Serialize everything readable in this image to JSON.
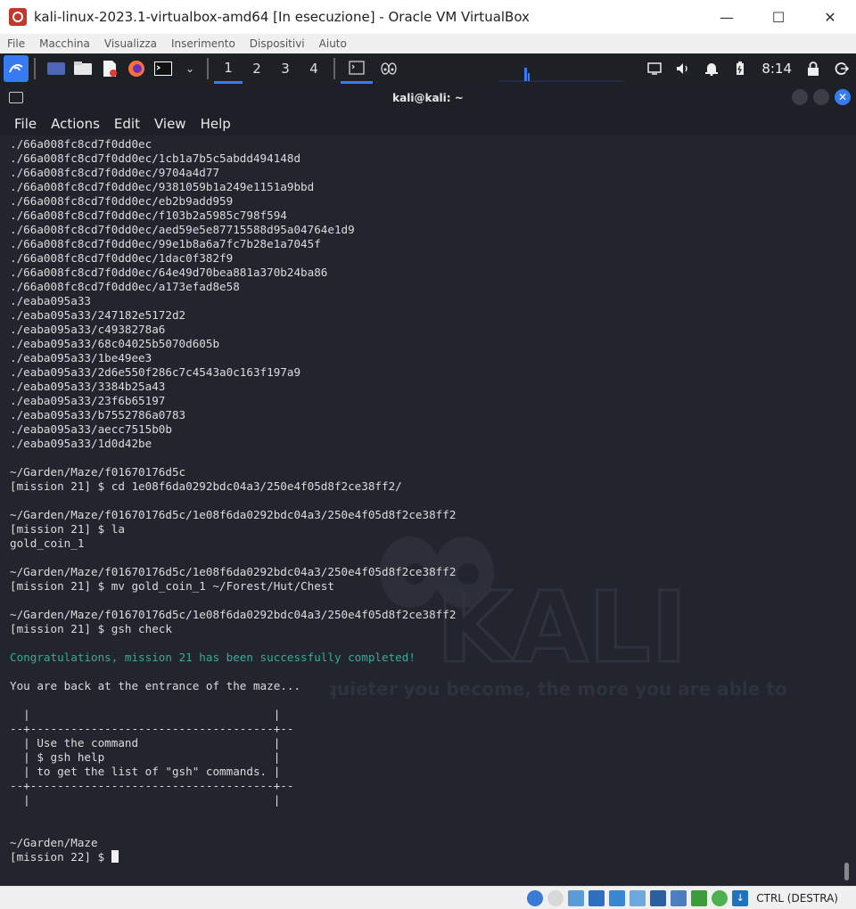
{
  "window": {
    "title": "kali-linux-2023.1-virtualbox-amd64 [In esecuzione] - Oracle VM VirtualBox",
    "minimize": "—",
    "maximize": "☐",
    "close": "✕"
  },
  "host_menu": [
    "File",
    "Macchina",
    "Visualizza",
    "Inserimento",
    "Dispositivi",
    "Aiuto"
  ],
  "guest_panel": {
    "workspaces": [
      "1",
      "2",
      "3",
      "4"
    ],
    "active_workspace": "1",
    "clock": "8:14"
  },
  "terminal": {
    "title": "kali@kali: ~",
    "menu": [
      "File",
      "Actions",
      "Edit",
      "View",
      "Help"
    ],
    "lines": [
      "./66a008fc8cd7f0dd0ec",
      "./66a008fc8cd7f0dd0ec/1cb1a7b5c5abdd494148d",
      "./66a008fc8cd7f0dd0ec/9704a4d77",
      "./66a008fc8cd7f0dd0ec/9381059b1a249e1151a9bbd",
      "./66a008fc8cd7f0dd0ec/eb2b9add959",
      "./66a008fc8cd7f0dd0ec/f103b2a5985c798f594",
      "./66a008fc8cd7f0dd0ec/aed59e5e87715588d95a04764e1d9",
      "./66a008fc8cd7f0dd0ec/99e1b8a6a7fc7b28e1a7045f",
      "./66a008fc8cd7f0dd0ec/1dac0f382f9",
      "./66a008fc8cd7f0dd0ec/64e49d70bea881a370b24ba86",
      "./66a008fc8cd7f0dd0ec/a173efad8e58",
      "./eaba095a33",
      "./eaba095a33/247182e5172d2",
      "./eaba095a33/c4938278a6",
      "./eaba095a33/68c04025b5070d605b",
      "./eaba095a33/1be49ee3",
      "./eaba095a33/2d6e550f286c7c4543a0c163f197a9",
      "./eaba095a33/3384b25a43",
      "./eaba095a33/23f6b65197",
      "./eaba095a33/b7552786a0783",
      "./eaba095a33/aecc7515b0b",
      "./eaba095a33/1d0d42be",
      "",
      "~/Garden/Maze/f01670176d5c",
      "[mission 21] $ cd 1e08f6da0292bdc04a3/250e4f05d8f2ce38ff2/",
      "",
      "~/Garden/Maze/f01670176d5c/1e08f6da0292bdc04a3/250e4f05d8f2ce38ff2",
      "[mission 21] $ la",
      "gold_coin_1",
      "",
      "~/Garden/Maze/f01670176d5c/1e08f6da0292bdc04a3/250e4f05d8f2ce38ff2",
      "[mission 21] $ mv gold_coin_1 ~/Forest/Hut/Chest",
      "",
      "~/Garden/Maze/f01670176d5c/1e08f6da0292bdc04a3/250e4f05d8f2ce38ff2",
      "[mission 21] $ gsh check",
      "",
      "Congratulations, mission 21 has been successfully completed!",
      "",
      "You are back at the entrance of the maze...",
      "",
      "  |                                    |",
      "--+------------------------------------+--",
      "  | Use the command                    |",
      "  | $ gsh help                         |",
      "  | to get the list of \"gsh\" commands. |",
      "--+------------------------------------+--",
      "  |                                    |",
      "",
      "",
      "~/Garden/Maze",
      "[mission 22] $ "
    ],
    "success_line_index": 36,
    "watermark_quote": "\"the quieter you become, the more you are able to hear\""
  },
  "status_bar": {
    "host_key": "CTRL (DESTRA)"
  },
  "colors": {
    "terminal_bg": "#23252e",
    "success_text": "#3aa89a",
    "kali_blue": "#367bf0"
  }
}
